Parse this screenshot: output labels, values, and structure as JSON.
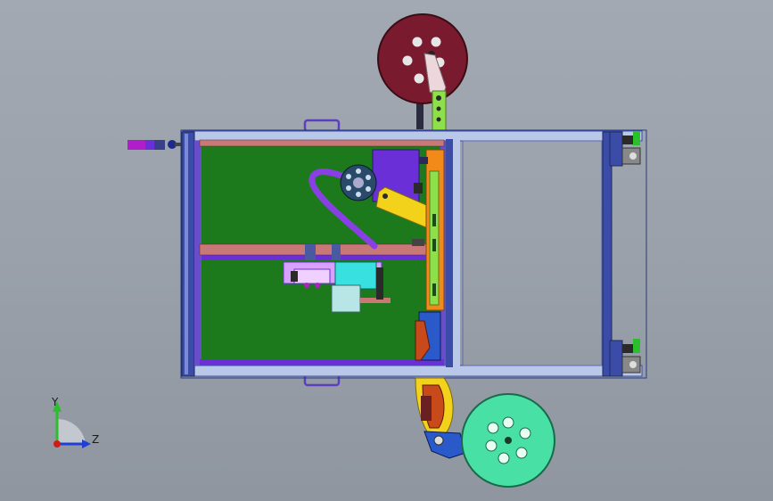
{
  "viewport": {
    "background_top": "#a3a9b3",
    "background_bottom": "#8f96a0"
  },
  "triad": {
    "y_label": "Y",
    "z_label": "Z",
    "y_color": "#2bbf2b",
    "z_color": "#1f3fd6",
    "x_color": "#d21a1a"
  },
  "colors": {
    "frame_blue": "#3a4ca8",
    "frame_light": "#b9c7e8",
    "panel_green": "#1c7a1c",
    "reel_top": "#7a1a2e",
    "reel_bottom": "#49e0a6",
    "rail_salmon": "#c97878",
    "purple_block": "#6a2fd6",
    "yellow_arm": "#f2d21b",
    "orange_bar": "#f28a1a",
    "cyan_part": "#39e0e0"
  },
  "icons": [
    "reel-icon",
    "caster-wheel-icon",
    "coordinate-triad-icon"
  ]
}
